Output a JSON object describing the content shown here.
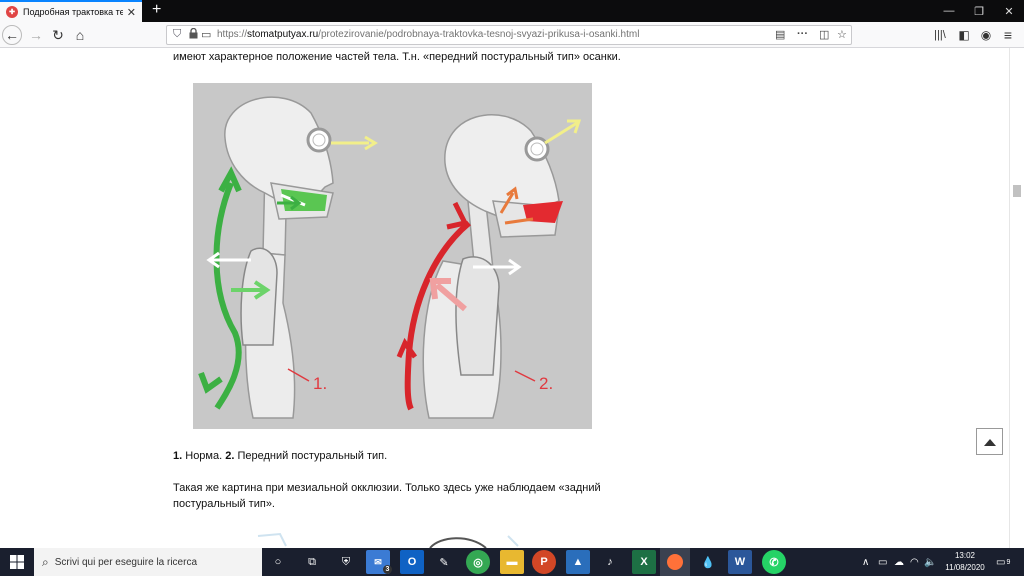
{
  "browser": {
    "tab_title": "Подробная трактовка тесной",
    "url_scheme": "https://",
    "url_host": "stomatputyax.ru",
    "url_path": "/protezirovanie/podrobnaya-traktovka-tesnoj-svyazi-prikusa-i-osanki.html"
  },
  "article": {
    "top_line": "имеют характерное положение частей тела. Т.н. «передний постуральный тип» осанки.",
    "figure_label_1": "1.",
    "figure_label_2": "2.",
    "caption_num1": "1.",
    "caption_text1": " Норма. ",
    "caption_num2": "2.",
    "caption_text2": " Передний постуральный тип.",
    "para_line1": "Такая же картина при мезиальной окклюзии. Только здесь уже наблюдаем «задний",
    "para_line2": "постуральный тип»."
  },
  "colors": {
    "normal_arrows": "#3cb043",
    "anterior_arrows": "#d8252b",
    "gaze_arrow": "#f2ef8a",
    "tab_accent": "#0a84ff",
    "taskbar": "#1a1f2e"
  },
  "taskbar": {
    "search_placeholder": "Scrivi qui per eseguire la ricerca",
    "mail_badge": "3",
    "time": "13:02",
    "date": "11/08/2020",
    "notifications": "9"
  }
}
